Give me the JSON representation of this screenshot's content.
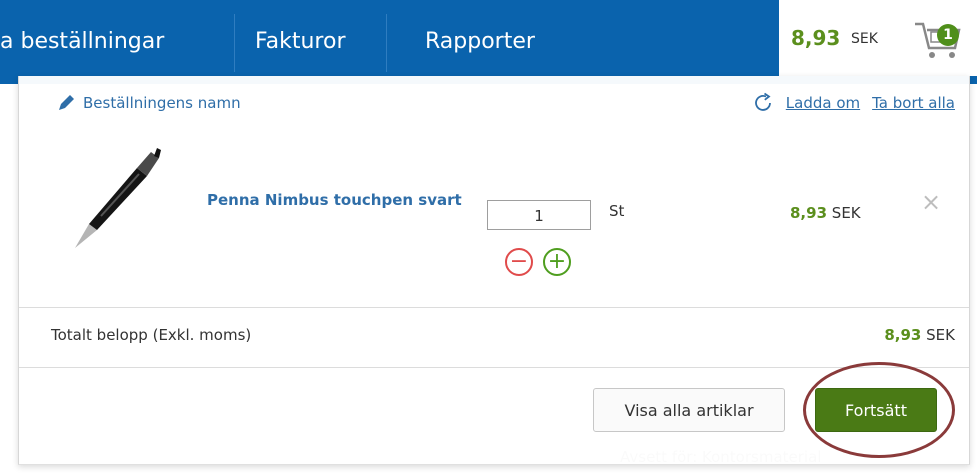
{
  "nav": {
    "items": [
      "a beställningar",
      "Fakturor",
      "Rapporter"
    ]
  },
  "cart": {
    "amount": "8,93",
    "currency": "SEK",
    "badge_count": "1"
  },
  "panel": {
    "order_name_label": "Beställningens namn",
    "reload_label": "Ladda om",
    "remove_all_label": "Ta bort alla",
    "product": {
      "name": "Penna Nimbus touchpen svart",
      "quantity": "1",
      "unit": "St",
      "price_amount": "8,93",
      "price_currency": "SEK"
    },
    "total": {
      "label": "Totalt belopp (Exkl. moms)",
      "amount": "8,93",
      "currency": "SEK"
    },
    "buttons": {
      "show_all": "Visa alla artiklar",
      "continue": "Fortsätt"
    }
  },
  "background": {
    "text_bottom": "Avsett för: Kontorsmaterial"
  },
  "colors": {
    "nav_bg": "#0a63ad",
    "price_green": "#5b8f1d",
    "button_green": "#4a7a15",
    "link_blue": "#2f6ea8",
    "highlight_ring": "#8a3a3a"
  }
}
